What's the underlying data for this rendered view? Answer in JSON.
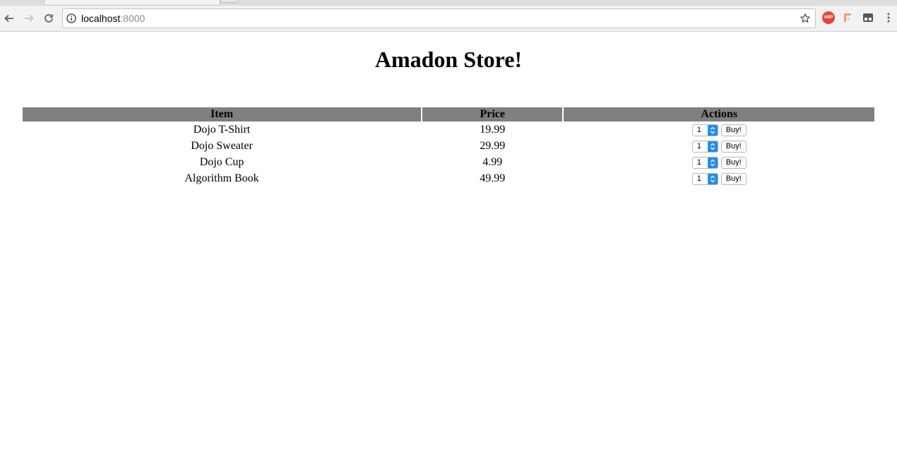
{
  "browser": {
    "url_host": "localhost",
    "url_port": ":8000",
    "extensions": [
      "adblock-plus-icon",
      "extension-icon",
      "extension-icon"
    ],
    "abp_label": "ABP"
  },
  "page": {
    "title": "Amadon Store!",
    "table": {
      "headers": [
        "Item",
        "Price",
        "Actions"
      ],
      "rows": [
        {
          "item": "Dojo T-Shirt",
          "price": "19.99",
          "qty": "1",
          "action": "Buy!"
        },
        {
          "item": "Dojo Sweater",
          "price": "29.99",
          "qty": "1",
          "action": "Buy!"
        },
        {
          "item": "Dojo Cup",
          "price": "4.99",
          "qty": "1",
          "action": "Buy!"
        },
        {
          "item": "Algorithm Book",
          "price": "49.99",
          "qty": "1",
          "action": "Buy!"
        }
      ]
    }
  },
  "colors": {
    "header_bg": "#808080",
    "select_accent": "#1f8ef1"
  }
}
